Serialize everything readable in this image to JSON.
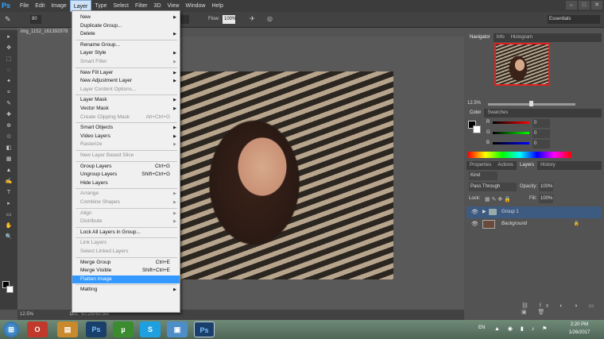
{
  "menubar": {
    "logo": "Ps",
    "items": [
      "File",
      "Edit",
      "Image",
      "Layer",
      "Type",
      "Select",
      "Filter",
      "3D",
      "View",
      "Window",
      "Help"
    ],
    "active": "Layer"
  },
  "options": {
    "brush_size": "80",
    "flow_label": "Flow:",
    "flow_value": "100%",
    "workspace": "Essentials"
  },
  "document": {
    "tab": "img_1152_161392978"
  },
  "layer_menu": {
    "items": [
      {
        "label": "New",
        "arrow": true,
        "state": "on"
      },
      {
        "label": "Duplicate Group...",
        "state": "on"
      },
      {
        "label": "Delete",
        "arrow": true,
        "state": "on"
      },
      {
        "sep": true
      },
      {
        "label": "Rename Group...",
        "state": "on"
      },
      {
        "label": "Layer Style",
        "arrow": true,
        "state": "on"
      },
      {
        "label": "Smart Filter",
        "arrow": true,
        "state": "dis"
      },
      {
        "sep": true
      },
      {
        "label": "New Fill Layer",
        "arrow": true,
        "state": "on"
      },
      {
        "label": "New Adjustment Layer",
        "arrow": true,
        "state": "on"
      },
      {
        "label": "Layer Content Options...",
        "state": "dis"
      },
      {
        "sep": true
      },
      {
        "label": "Layer Mask",
        "arrow": true,
        "state": "on"
      },
      {
        "label": "Vector Mask",
        "arrow": true,
        "state": "on"
      },
      {
        "label": "Create Clipping Mask",
        "shortcut": "Alt+Ctrl+G",
        "state": "dis"
      },
      {
        "sep": true
      },
      {
        "label": "Smart Objects",
        "arrow": true,
        "state": "on"
      },
      {
        "label": "Video Layers",
        "arrow": true,
        "state": "on"
      },
      {
        "label": "Rasterize",
        "arrow": true,
        "state": "dis"
      },
      {
        "sep": true
      },
      {
        "label": "New Layer Based Slice",
        "state": "dis"
      },
      {
        "sep": true
      },
      {
        "label": "Group Layers",
        "shortcut": "Ctrl+G",
        "state": "on"
      },
      {
        "label": "Ungroup Layers",
        "shortcut": "Shift+Ctrl+G",
        "state": "on"
      },
      {
        "label": "Hide Layers",
        "state": "on"
      },
      {
        "sep": true
      },
      {
        "label": "Arrange",
        "arrow": true,
        "state": "dis"
      },
      {
        "label": "Combine Shapes",
        "arrow": true,
        "state": "dis"
      },
      {
        "sep": true
      },
      {
        "label": "Align",
        "arrow": true,
        "state": "dis"
      },
      {
        "label": "Distribute",
        "arrow": true,
        "state": "dis"
      },
      {
        "sep": true
      },
      {
        "label": "Lock All Layers in Group...",
        "state": "on"
      },
      {
        "sep": true
      },
      {
        "label": "Link Layers",
        "state": "dis"
      },
      {
        "label": "Select Linked Layers",
        "state": "dis"
      },
      {
        "sep": true
      },
      {
        "label": "Merge Group",
        "shortcut": "Ctrl+E",
        "state": "on"
      },
      {
        "label": "Merge Visible",
        "shortcut": "Shift+Ctrl+E",
        "state": "on"
      },
      {
        "label": "Flatten Image",
        "state": "hl"
      },
      {
        "sep": true
      },
      {
        "label": "Matting",
        "arrow": true,
        "state": "on"
      }
    ]
  },
  "navigator": {
    "tabs": [
      "Navigator",
      "Info",
      "Histogram"
    ],
    "zoom": "12.5%"
  },
  "color_panel": {
    "tabs": [
      "Color",
      "Swatches"
    ],
    "r_label": "R",
    "r": "0",
    "g_label": "G",
    "g": "0",
    "b_label": "B",
    "b": "0"
  },
  "layers_panel": {
    "tabs": [
      "Properties",
      "Actions",
      "Layers",
      "History"
    ],
    "kind": "Kind",
    "blend": "Pass Through",
    "opacity_label": "Opacity:",
    "opacity": "100%",
    "lock_label": "Lock:",
    "fill_label": "Fill:",
    "fill": "100%",
    "layers": [
      {
        "name": "Group 1"
      },
      {
        "name": "Background"
      }
    ]
  },
  "status": {
    "zoom": "12.5%",
    "doc": "Doc: 60.2M/60.5M"
  },
  "taskbar": {
    "lang": "EN",
    "time": "2:20 PM",
    "date": "1/26/2017"
  },
  "colors": {
    "accent": "#3399ff",
    "menu_bg": "#f0f0f0"
  }
}
